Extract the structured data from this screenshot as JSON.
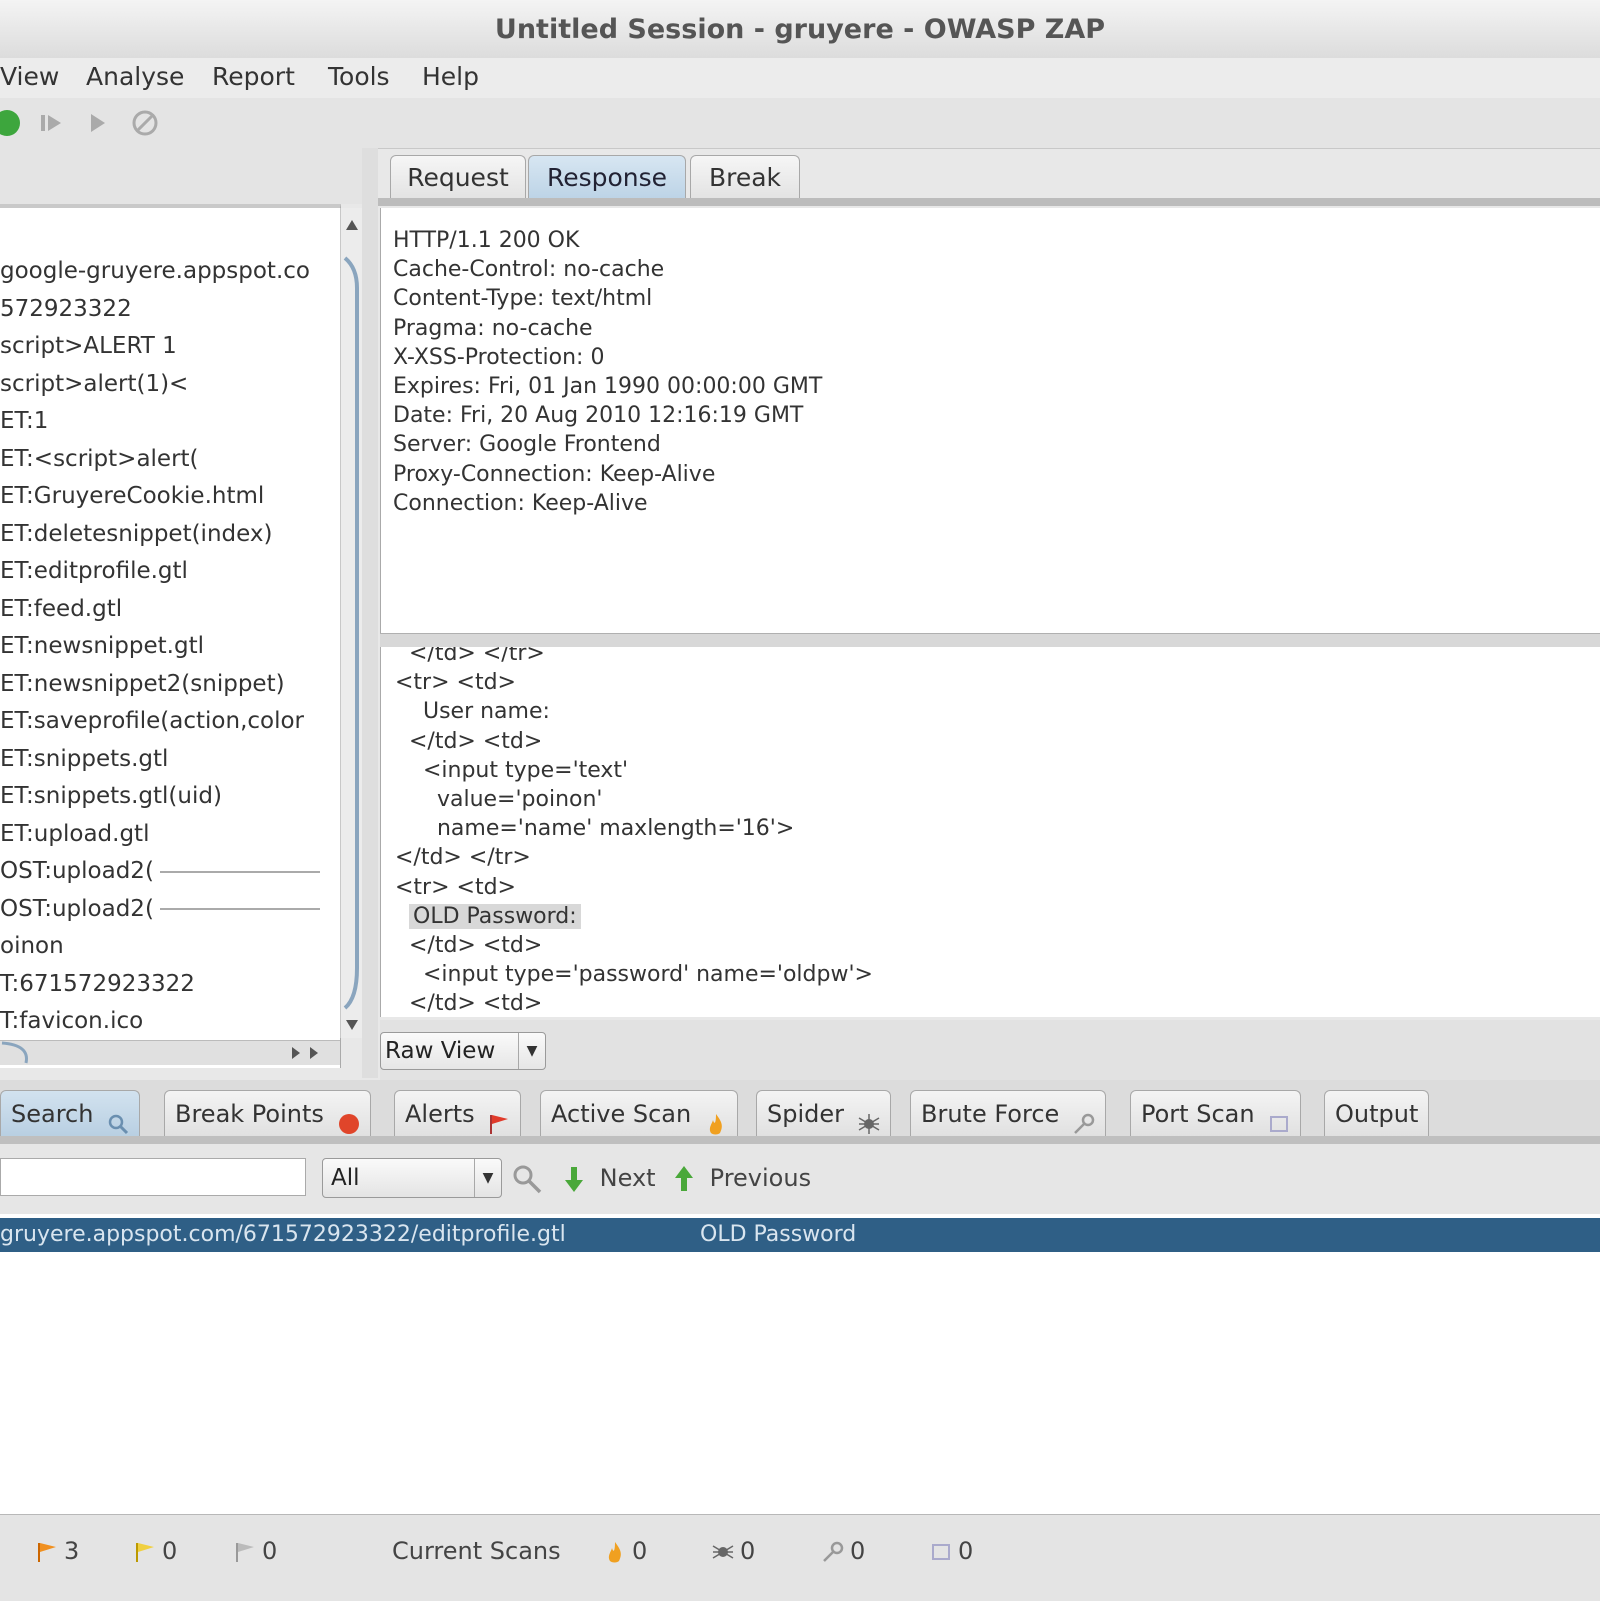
{
  "window": {
    "title": "Untitled Session - gruyere - OWASP ZAP"
  },
  "menu": [
    "View",
    "Analyse",
    "Report",
    "Tools",
    "Help"
  ],
  "toolbar": {
    "icons": [
      "start-icon",
      "step-icon",
      "continue-icon",
      "drop-icon"
    ]
  },
  "tree": {
    "items": [
      "google-gruyere.appspot.co",
      "572923322",
      "script>ALERT 1",
      "script>alert(1)<",
      "ET:1",
      "ET:<script>alert(",
      "ET:GruyereCookie.html",
      "ET:deletesnippet(index)",
      "ET:editprofile.gtl",
      "ET:feed.gtl",
      "ET:newsnippet.gtl",
      "ET:newsnippet2(snippet)",
      "ET:saveprofile(action,color",
      "ET:snippets.gtl",
      "ET:snippets.gtl(uid)",
      "ET:upload.gtl",
      "OST:upload2(",
      "OST:upload2(",
      "oinon",
      "T:671572923322",
      "T:favicon.ico"
    ]
  },
  "tabs": {
    "request": "Request",
    "response": "Response",
    "break": "Break"
  },
  "response_headers": [
    "HTTP/1.1 200 OK",
    "Cache-Control: no-cache",
    "Content-Type: text/html",
    "Pragma: no-cache",
    "X-XSS-Protection: 0",
    "Expires: Fri, 01 Jan 1990 00:00:00 GMT",
    "Date: Fri, 20 Aug 2010 12:16:19 GMT",
    "Server: Google Frontend",
    "Proxy-Connection: Keep-Alive",
    "Connection: Keep-Alive"
  ],
  "response_body": {
    "lines_before": [
      "  </td> </tr>",
      "<tr> <td>",
      "    User name:",
      "  </td> <td>",
      "    <input type='text'",
      "      value='poinon'",
      "      name='name' maxlength='16'>",
      "</td> </tr>",
      "<tr> <td>"
    ],
    "highlight": "OLD Password:",
    "lines_after": [
      "  </td> <td>",
      "    <input type='password' name='oldpw'>",
      "  </td> <td>"
    ]
  },
  "view_select": {
    "value": "Raw View"
  },
  "bottom_tabs": [
    {
      "label": "Search",
      "icon": "search-icon"
    },
    {
      "label": "Break Points",
      "icon": "breakpoint-icon"
    },
    {
      "label": "Alerts",
      "icon": "flag-icon"
    },
    {
      "label": "Active Scan",
      "icon": "flame-icon"
    },
    {
      "label": "Spider",
      "icon": "spider-icon"
    },
    {
      "label": "Brute Force",
      "icon": "key-icon"
    },
    {
      "label": "Port Scan",
      "icon": "port-icon"
    },
    {
      "label": "Output",
      "icon": ""
    }
  ],
  "search": {
    "input_value": "",
    "scope": "All",
    "next_label": "Next",
    "previous_label": "Previous"
  },
  "results": [
    {
      "url": "gruyere.appspot.com/671572923322/editprofile.gtl",
      "match": "OLD Password"
    }
  ],
  "status": {
    "alerts_high": "3",
    "alerts_medium": "0",
    "alerts_low": "0",
    "current_scans_label": "Current Scans",
    "scan_active": "0",
    "scan_spider": "0",
    "scan_brute": "0",
    "scan_port": "0"
  },
  "colors": {
    "selection": "#2f5f86",
    "tab_active": "#bcd3e6"
  }
}
